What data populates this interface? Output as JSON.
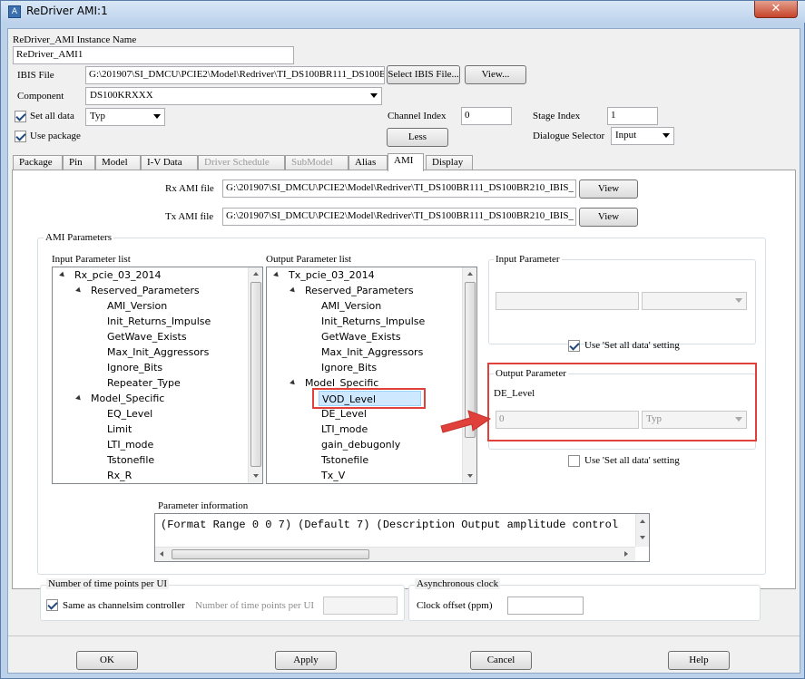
{
  "window": {
    "title": "ReDriver AMI:1",
    "close_glyph": "✕"
  },
  "instance": {
    "label": "ReDriver_AMI Instance Name",
    "value": "ReDriver_AMI1"
  },
  "ibis": {
    "label": "IBIS File",
    "path": "G:\\201907\\SI_DMCU\\PCIE2\\Model\\Redriver\\TI_DS100BR111_DS100E",
    "select_button": "Select IBIS File...",
    "view_button": "View..."
  },
  "component": {
    "label": "Component",
    "value": "DS100KRXXX"
  },
  "set_all_data": {
    "label": "Set all data",
    "checked": true,
    "value": "Typ"
  },
  "use_package": {
    "label": "Use package",
    "checked": true
  },
  "channel_index": {
    "label": "Channel Index",
    "value": "0"
  },
  "stage_index": {
    "label": "Stage Index",
    "value": "1"
  },
  "less_button": "Less",
  "dialogue_selector": {
    "label": "Dialogue Selector",
    "value": "Input"
  },
  "tabs": [
    {
      "label": "Package",
      "state": "normal"
    },
    {
      "label": "Pin",
      "state": "normal"
    },
    {
      "label": "Model",
      "state": "normal"
    },
    {
      "label": "I-V Data",
      "state": "normal"
    },
    {
      "label": "Driver Schedule",
      "state": "disabled"
    },
    {
      "label": "SubModel",
      "state": "disabled"
    },
    {
      "label": "Alias",
      "state": "normal"
    },
    {
      "label": "AMI",
      "state": "active"
    },
    {
      "label": "Display",
      "state": "normal"
    }
  ],
  "rx_ami": {
    "label": "Rx AMI file",
    "path": "G:\\201907\\SI_DMCU\\PCIE2\\Model\\Redriver\\TI_DS100BR111_DS100BR210_IBIS_",
    "view_button": "View"
  },
  "tx_ami": {
    "label": "Tx AMI file",
    "path": "G:\\201907\\SI_DMCU\\PCIE2\\Model\\Redriver\\TI_DS100BR111_DS100BR210_IBIS_",
    "view_button": "View"
  },
  "ami_parameters": {
    "title": "AMI Parameters",
    "input_list": {
      "title": "Input Parameter list",
      "items": [
        "Rx_pcie_03_2014",
        "Reserved_Parameters",
        "AMI_Version",
        "Init_Returns_Impulse",
        "GetWave_Exists",
        "Max_Init_Aggressors",
        "Ignore_Bits",
        "Repeater_Type",
        "Model_Specific",
        "EQ_Level",
        "Limit",
        "LTI_mode",
        "Tstonefile",
        "Rx_R"
      ]
    },
    "output_list": {
      "title": "Output Parameter list",
      "items": [
        "Tx_pcie_03_2014",
        "Reserved_Parameters",
        "AMI_Version",
        "Init_Returns_Impulse",
        "GetWave_Exists",
        "Max_Init_Aggressors",
        "Ignore_Bits",
        "Model_Specific",
        "VOD_Level",
        "DE_Level",
        "LTI_mode",
        "gain_debugonly",
        "Tstonefile",
        "Tx_V"
      ],
      "selected": "VOD_Level"
    },
    "input_parameter": {
      "title": "Input Parameter",
      "value": "",
      "combo": "",
      "use_set_all_label": "Use 'Set all data' setting",
      "use_set_all_checked": true
    },
    "output_parameter": {
      "title": "Output Parameter",
      "name": "DE_Level",
      "value": "0",
      "combo": "Typ",
      "use_set_all_label": "Use 'Set all data' setting",
      "use_set_all_checked": false
    },
    "parameter_information": {
      "title": "Parameter information",
      "text": "(Format Range 0 0 7) (Default 7) (Description Output amplitude control"
    }
  },
  "time_points": {
    "title": "Number of time points per UI",
    "same_label": "Same as channelsim controller",
    "same_checked": true,
    "count_label": "Number of time points per UI",
    "count_value": ""
  },
  "async_clock": {
    "title": "Asynchronous clock",
    "offset_label": "Clock offset (ppm)",
    "offset_value": ""
  },
  "buttons": {
    "ok": "OK",
    "apply": "Apply",
    "cancel": "Cancel",
    "help": "Help"
  },
  "colors": {
    "highlight": "#e0413a",
    "titlebar": "#bdd3ec"
  }
}
